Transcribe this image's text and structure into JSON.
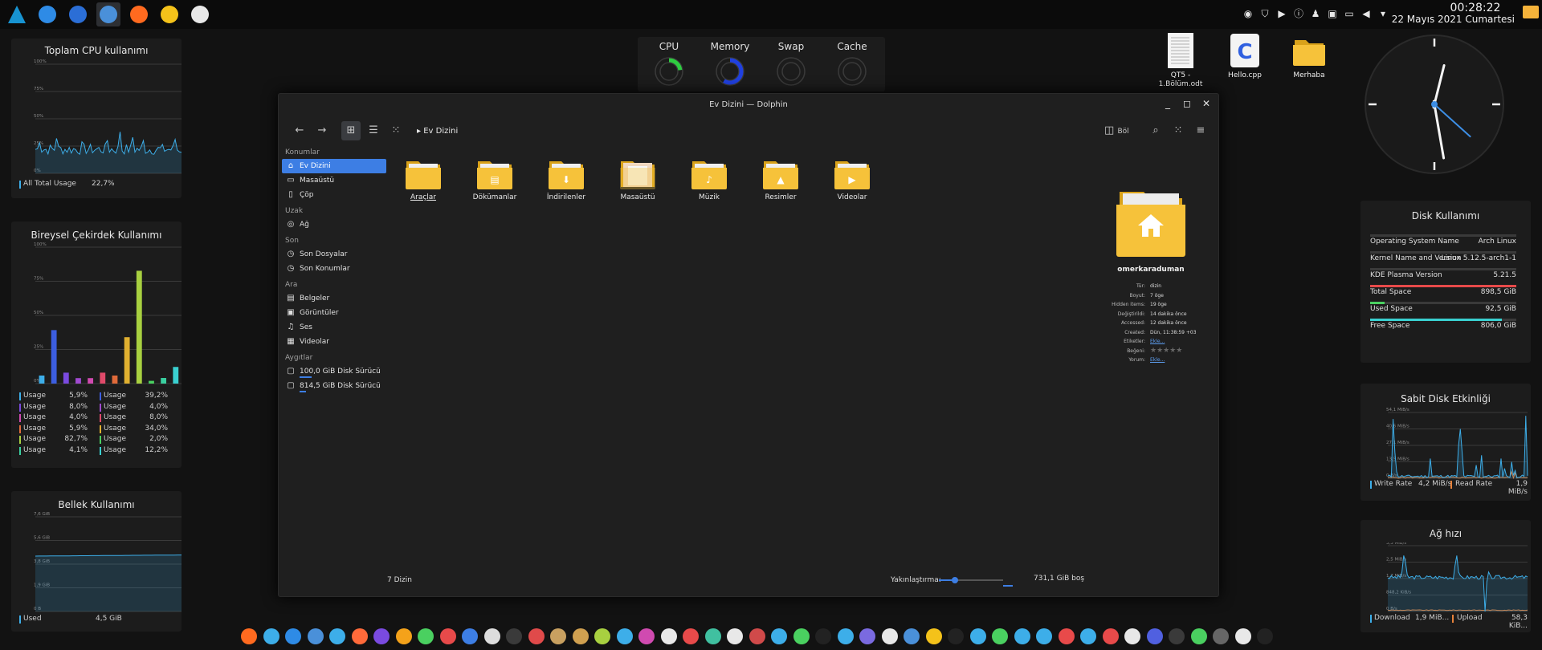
{
  "panel": {
    "launchers": [
      {
        "name": "arch-logo-icon",
        "color": "#1793d1"
      },
      {
        "name": "app-blue-icon",
        "color": "#2e8be6"
      },
      {
        "name": "app-moon-icon",
        "color": "#2b6ed6"
      },
      {
        "name": "app-dolphin-icon",
        "color": "#4a90d9"
      },
      {
        "name": "firefox-icon",
        "color": "#ff6a1f"
      },
      {
        "name": "app-yellow-icon",
        "color": "#f4c21a"
      },
      {
        "name": "app-ring-icon",
        "color": "#e8e8e8"
      }
    ],
    "clock_time": "00:28:22",
    "clock_date": "22 Mayıs 2021 Cumartesi"
  },
  "cpu_widget": {
    "title": "Toplam CPU kullanımı",
    "ticks": [
      "100%",
      "75%",
      "50%",
      "25%",
      "0%"
    ],
    "legend_label": "All Total Usage",
    "legend_value": "22,7%",
    "series_color": "#3daee9"
  },
  "core_widget": {
    "title": "Bireysel Çekirdek Kullanımı",
    "ticks": [
      "100%",
      "75%",
      "50%",
      "25%",
      "0%"
    ],
    "cores": [
      {
        "label": "Usage",
        "value": "5,9%",
        "v": 5.9,
        "color": "#3daee9"
      },
      {
        "label": "Usage",
        "value": "39,2%",
        "v": 39.2,
        "color": "#3c5ee0"
      },
      {
        "label": "Usage",
        "value": "8,0%",
        "v": 8.0,
        "color": "#7a4ae0"
      },
      {
        "label": "Usage",
        "value": "4,0%",
        "v": 4.0,
        "color": "#a04ad0"
      },
      {
        "label": "Usage",
        "value": "4,0%",
        "v": 4.0,
        "color": "#d04ab0"
      },
      {
        "label": "Usage",
        "value": "8,0%",
        "v": 8.0,
        "color": "#e04a6a"
      },
      {
        "label": "Usage",
        "value": "5,9%",
        "v": 5.9,
        "color": "#e06a3a"
      },
      {
        "label": "Usage",
        "value": "34,0%",
        "v": 34.0,
        "color": "#e0b030"
      },
      {
        "label": "Usage",
        "value": "82,7%",
        "v": 82.7,
        "color": "#a8d040"
      },
      {
        "label": "Usage",
        "value": "2,0%",
        "v": 2.0,
        "color": "#4ad060"
      },
      {
        "label": "Usage",
        "value": "4,1%",
        "v": 4.1,
        "color": "#3ad0a0"
      },
      {
        "label": "Usage",
        "value": "12,2%",
        "v": 12.2,
        "color": "#3ad0d0"
      }
    ]
  },
  "memory_widget": {
    "title": "Bellek Kullanımı",
    "ticks": [
      "7,6 GiB",
      "5,6 GiB",
      "3,8 GiB",
      "1,9 GiB",
      "0 B"
    ],
    "legend_label": "Used",
    "legend_value": "4,5 GiB",
    "series_color": "#3daee9"
  },
  "gauges": [
    {
      "name": "CPU",
      "fraction": 0.23,
      "color": "#2ecc40"
    },
    {
      "name": "Memory",
      "fraction": 0.59,
      "color": "#2040e0"
    },
    {
      "name": "Swap",
      "fraction": 0,
      "color": "#888888"
    },
    {
      "name": "Cache",
      "fraction": 0,
      "color": "#888888"
    }
  ],
  "desktop": {
    "icons": [
      {
        "label": "QT5 - 1.Bölüm.odt",
        "kind": "document"
      },
      {
        "label": "Hello.cpp",
        "kind": "cpp"
      },
      {
        "label": "Merhaba",
        "kind": "folder"
      }
    ]
  },
  "dolphin": {
    "title": "Ev Dizini — Dolphin",
    "breadcrumb": "Ev Dizini",
    "split_label": "Böl",
    "places": {
      "sections": [
        {
          "title": "Konumlar",
          "items": [
            {
              "label": "Ev Dizini",
              "icon": "home-icon",
              "glyph": "⌂",
              "selected": true
            },
            {
              "label": "Masaüstü",
              "icon": "desktop-icon",
              "glyph": "▭"
            },
            {
              "label": "Çöp",
              "icon": "trash-icon",
              "glyph": "▯"
            }
          ]
        },
        {
          "title": "Uzak",
          "items": [
            {
              "label": "Ağ",
              "icon": "network-icon",
              "glyph": "◎"
            }
          ]
        },
        {
          "title": "Son",
          "items": [
            {
              "label": "Son Dosyalar",
              "icon": "recent-files-icon",
              "glyph": "◷"
            },
            {
              "label": "Son Konumlar",
              "icon": "recent-locations-icon",
              "glyph": "◷"
            }
          ]
        },
        {
          "title": "Ara",
          "items": [
            {
              "label": "Belgeler",
              "icon": "documents-icon",
              "glyph": "▤"
            },
            {
              "label": "Görüntüler",
              "icon": "images-icon",
              "glyph": "▣"
            },
            {
              "label": "Ses",
              "icon": "audio-icon",
              "glyph": "♫"
            },
            {
              "label": "Videolar",
              "icon": "videos-icon",
              "glyph": "▦"
            }
          ]
        },
        {
          "title": "Aygıtlar",
          "items": [
            {
              "label": "100,0 GiB Disk Sürücü",
              "icon": "drive-icon",
              "glyph": "▢",
              "capacity": 0.15
            },
            {
              "label": "814,5 GiB Disk Sürücü",
              "icon": "drive-icon",
              "glyph": "▢",
              "capacity": 0.08
            }
          ]
        }
      ]
    },
    "folders": [
      {
        "label": "Araçlar",
        "emblem": "",
        "kind": "plain"
      },
      {
        "label": "Dökümanlar",
        "emblem": "▤",
        "kind": "emblem"
      },
      {
        "label": "İndirilenler",
        "emblem": "⬇",
        "kind": "emblem"
      },
      {
        "label": "Masaüstü",
        "emblem": "",
        "kind": "desktop"
      },
      {
        "label": "Müzik",
        "emblem": "♪",
        "kind": "emblem"
      },
      {
        "label": "Resimler",
        "emblem": "▲",
        "kind": "emblem"
      },
      {
        "label": "Videolar",
        "emblem": "▶",
        "kind": "emblem"
      }
    ],
    "info": {
      "name": "omerkaraduman",
      "rows": [
        {
          "k": "Tür:",
          "v": "dizin"
        },
        {
          "k": "Boyut:",
          "v": "7 öge"
        },
        {
          "k": "Hidden items:",
          "v": "19 öge"
        },
        {
          "k": "Değiştirildi:",
          "v": "14 dakika önce"
        },
        {
          "k": "Accessed:",
          "v": "12 dakika önce"
        },
        {
          "k": "Created:",
          "v": "Dün, 11:38:59 +03"
        },
        {
          "k": "Etiketler:",
          "v": "Ekle...",
          "link": true
        },
        {
          "k": "Beğeni:",
          "v": "★★★★★",
          "stars": true
        },
        {
          "k": "Yorum:",
          "v": "Ekle...",
          "link": true
        }
      ]
    },
    "status": {
      "count": "7 Dizin",
      "zoom_label": "Yakınlaştırma:",
      "zoom_fraction": 0.25,
      "free": "731,1 GiB boş"
    }
  },
  "clock_widget": {
    "hour": 0,
    "minute": 28,
    "second": 22
  },
  "disk_widget": {
    "title": "Disk Kullanımı",
    "rows": [
      {
        "k": "Operating System Name",
        "v": "Arch Linux",
        "bar": 0,
        "color": "#3a3a3a"
      },
      {
        "k": "Kernel Name and Version",
        "v": "Linux 5.12.5-arch1-1",
        "bar": 0,
        "color": "#3a3a3a"
      },
      {
        "k": "KDE Plasma Version",
        "v": "5.21.5",
        "bar": 0,
        "color": "#3a3a3a"
      },
      {
        "k": "Total Space",
        "v": "898,5 GiB",
        "bar": 1.0,
        "color": "#e84a4a"
      },
      {
        "k": "Used Space",
        "v": "92,5 GiB",
        "bar": 0.1,
        "color": "#4ad060"
      },
      {
        "k": "Free Space",
        "v": "806,0 GiB",
        "bar": 0.9,
        "color": "#3ad0d0"
      }
    ]
  },
  "disk_activity": {
    "title": "Sabit Disk Etkinliği",
    "ticks": [
      "54,1 MiB/s",
      "40,6 MiB/s",
      "27,1 MiB/s",
      "13,5 MiB/s",
      "0 B/s"
    ],
    "write_label": "Write Rate",
    "write_value": "4,2 MiB/s",
    "read_label": "Read Rate",
    "read_value": "1,9 MiB/s",
    "write_color": "#3daee9",
    "read_color": "#e8823a"
  },
  "net_widget": {
    "title": "Ağ hızı",
    "ticks": [
      "3,3 MiB/s",
      "2,5 MiB/s",
      "1,7 MiB/s",
      "848,2 KiB/s",
      "0 B/s"
    ],
    "down_label": "Download",
    "down_value": "1,9 MiB...",
    "up_label": "Upload",
    "up_value": "58,3 KiB...",
    "down_color": "#3daee9",
    "up_color": "#e8823a"
  },
  "dock": {
    "colors": [
      "#ff6a1f",
      "#3daee9",
      "#2e8be6",
      "#4a90d9",
      "#3daee9",
      "#ff6a3a",
      "#7a4ae0",
      "#f4a21a",
      "#4ad060",
      "#e84a4a",
      "#3d7ee4",
      "#dddddd",
      "#3a3a3a",
      "#e04a4a",
      "#c8a060",
      "#d0a050",
      "#a8d040",
      "#3daee9",
      "#d04ab0",
      "#e8e8e8",
      "#e84a4a",
      "#40c0a0",
      "#e8e8e8",
      "#d04a4a",
      "#3daee9",
      "#4ad060",
      "#222222",
      "#3daee9",
      "#7a6ae0",
      "#e8e8e8",
      "#4a90d9",
      "#f4c21a",
      "#222222",
      "#3daee9",
      "#4ad060",
      "#3daee9",
      "#3daee9",
      "#e84a4a",
      "#3daee9",
      "#e84a4a",
      "#e8e8e8",
      "#5060e0",
      "#3a3a3a",
      "#4ad060",
      "#666666",
      "#e8e8e8",
      "#222222"
    ]
  }
}
